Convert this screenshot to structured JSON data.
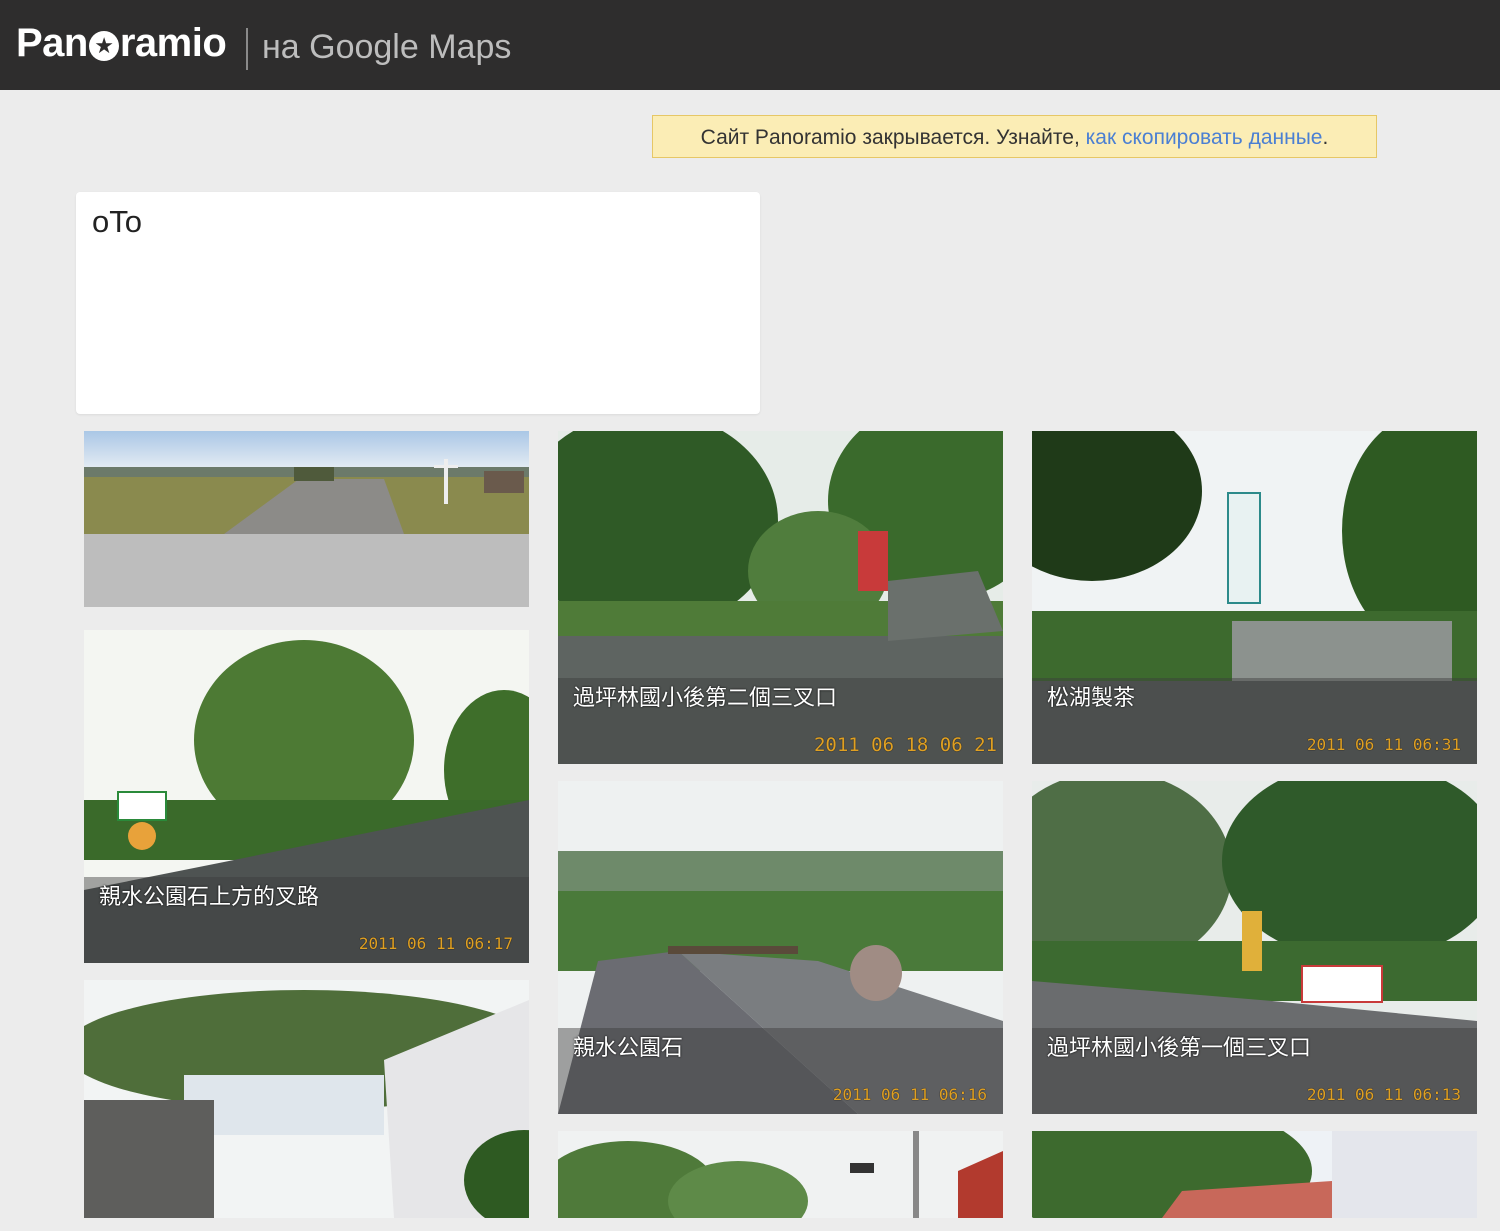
{
  "header": {
    "logo_left": "Pan",
    "logo_right": "ramio",
    "subtitle": "на Google Maps"
  },
  "notice": {
    "text": "Сайт Panoramio закрывается. Узнайте, ",
    "link": "как скопировать данные",
    "end": "."
  },
  "profile": {
    "name": "oTo"
  },
  "photos": [
    {
      "caption": "",
      "stamp": ""
    },
    {
      "caption": "過坪林國小後第二個三叉口",
      "stamp": "2011 06 18  06 21"
    },
    {
      "caption": "松湖製茶",
      "stamp": "2011 06 11 06:31"
    },
    {
      "caption": "親水公園石上方的叉路",
      "stamp": "2011 06 11 06:17"
    },
    {
      "caption": "親水公園石",
      "stamp": "2011 06 11 06:16"
    },
    {
      "caption": "過坪林國小後第一個三叉口",
      "stamp": "2011 06 11  06:13"
    },
    {
      "caption": "",
      "stamp": ""
    },
    {
      "caption": "",
      "stamp": ""
    },
    {
      "caption": "",
      "stamp": ""
    }
  ]
}
